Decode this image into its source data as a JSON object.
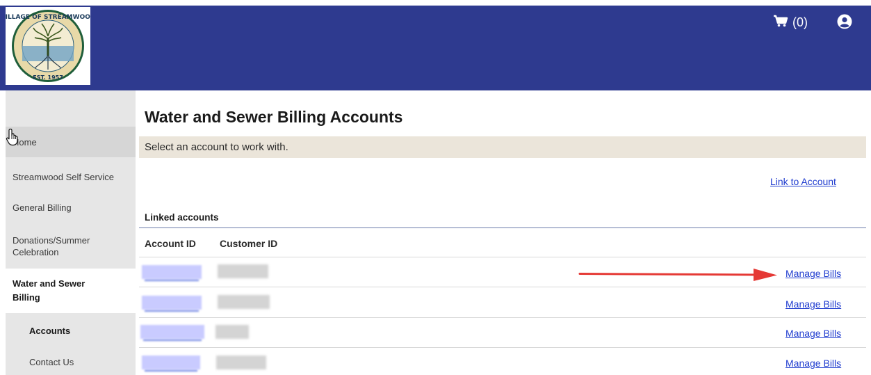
{
  "header": {
    "cart_label": "(0)",
    "logo_text": [
      "VILLAGE OF STREAMWOOD",
      "EST. 1957"
    ]
  },
  "sidebar": {
    "items": [
      {
        "label": "Home"
      },
      {
        "label": "Streamwood Self Service"
      },
      {
        "label": "General Billing"
      },
      {
        "label": "Donations/Summer Celebration"
      },
      {
        "label": "Water and Sewer Billing"
      },
      {
        "label": "Accounts"
      },
      {
        "label": "Contact Us"
      }
    ]
  },
  "main": {
    "title": "Water and Sewer Billing Accounts",
    "instruction": "Select an account to work with.",
    "link_account": "Link to Account",
    "linked_heading": "Linked accounts",
    "columns": [
      "Account ID",
      "Customer ID"
    ],
    "rows": [
      {
        "account_id": "",
        "customer_id": "",
        "action": "Manage Bills"
      },
      {
        "account_id": "",
        "customer_id": "",
        "action": "Manage Bills"
      },
      {
        "account_id": "",
        "customer_id": "",
        "action": "Manage Bills"
      },
      {
        "account_id": "",
        "customer_id": "",
        "action": "Manage Bills"
      }
    ]
  },
  "colors": {
    "header_bg": "#2e3a8f",
    "sidebar_bg": "#e6e6e6",
    "instruction_bg": "#ebe5da",
    "link": "#1f3ccf",
    "annotation_arrow": "#e53935"
  },
  "icons": [
    "cart-icon",
    "user-circle-icon",
    "hand-cursor-icon",
    "red-arrow-annotation"
  ]
}
